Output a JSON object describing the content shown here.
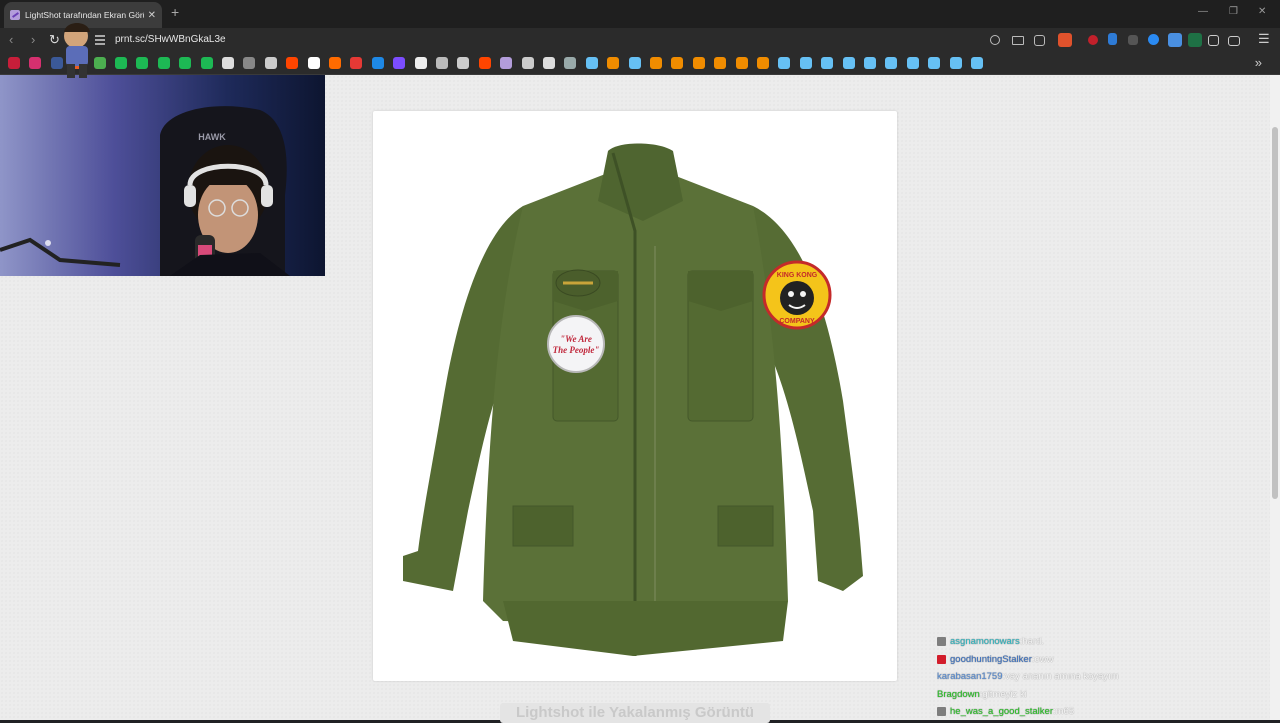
{
  "browser": {
    "tab_title": "LightShot tarafından Ekran Görü",
    "tab_close": "✕",
    "new_tab": "+",
    "window_controls": [
      "—",
      "❐",
      "✕"
    ],
    "url": "prnt.sc/SHwWBnGkaL3e",
    "bookmarks_more": "»"
  },
  "page": {
    "caption": "Lightshot ile Yakalanmış Görüntü",
    "patch_left_text": "\"We Are The People\"",
    "patch_right_text": "King Kong Company"
  },
  "chat": {
    "messages": [
      {
        "user": "asgnamonowars",
        "text": "hard.",
        "color": "#2fb9c4",
        "badge": "#7e7e7e"
      },
      {
        "user": "goodhuntingStalker",
        "text": "oww",
        "color": "#3c73c4",
        "badge": "#d21d2b"
      },
      {
        "user": "karabasan1759",
        "text": "vay ananın amına koyayım",
        "color": "#5a8fd6",
        "badge": ""
      },
      {
        "user": "Bragdown",
        "text": "gitmeyiz ki",
        "color": "#29c426",
        "badge": ""
      },
      {
        "user": "he_was_a_good_stalker",
        "text": "m65",
        "color": "#29c426",
        "badge": "#7e7e7e"
      }
    ]
  }
}
